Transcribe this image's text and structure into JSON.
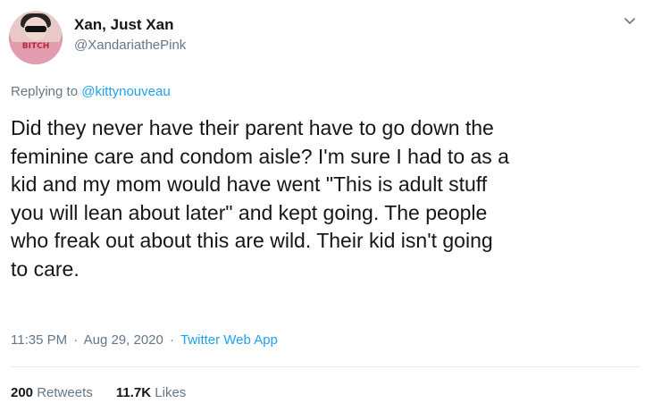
{
  "author": {
    "display_name": "Xan, Just Xan",
    "handle": "@XandariathePink",
    "avatar_text": "BITCH"
  },
  "reply": {
    "prefix": "Replying to",
    "to_handle": "@kittynouveau"
  },
  "tweet": {
    "text": "Did they never have their parent have to go down the\nfeminine care and condom aisle? I'm sure I had to as a\nkid and my mom would have went \"This is adult stuff\nyou will lean about later\" and kept going. The people\nwho freak out about this are wild. Their kid isn't going\nto care."
  },
  "meta": {
    "time": "11:35 PM",
    "date": "Aug 29, 2020",
    "separator": "·",
    "source": "Twitter Web App"
  },
  "stats": {
    "retweets_count": "200",
    "retweets_label": "Retweets",
    "likes_count": "11.7K",
    "likes_label": "Likes"
  },
  "colors": {
    "text": "#14171a",
    "secondary": "#657786",
    "link": "#1da1f2",
    "divider": "#e6ecf0"
  },
  "icons": {
    "menu": "chevron-down-icon"
  }
}
